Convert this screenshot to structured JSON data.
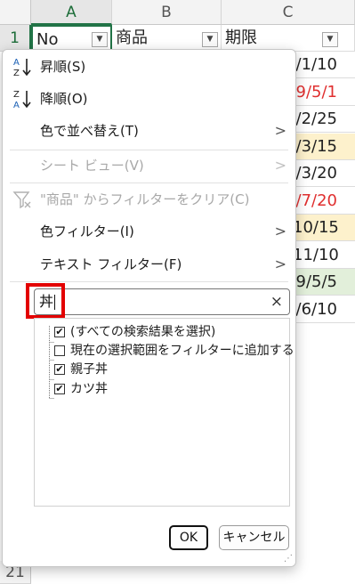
{
  "sheet": {
    "columns": [
      "A",
      "B",
      "C"
    ],
    "header_cells": {
      "a": "No",
      "b": "商品",
      "c": "期限"
    },
    "row_numbers": {
      "first": "1",
      "last": "21"
    },
    "dates": [
      {
        "text": "/1/10",
        "color": "#222222",
        "bg": "#ffffff"
      },
      {
        "text": "9/5/1",
        "color": "#e03030",
        "bg": "#ffffff"
      },
      {
        "text": "/2/25",
        "color": "#222222",
        "bg": "#ffffff"
      },
      {
        "text": "/3/15",
        "color": "#222222",
        "bg": "#fdf1cc"
      },
      {
        "text": "/3/20",
        "color": "#222222",
        "bg": "#ffffff"
      },
      {
        "text": "/7/20",
        "color": "#e03030",
        "bg": "#ffffff"
      },
      {
        "text": "10/15",
        "color": "#222222",
        "bg": "#fdf1cc"
      },
      {
        "text": "11/10",
        "color": "#222222",
        "bg": "#ffffff"
      },
      {
        "text": "9/5/5",
        "color": "#222222",
        "bg": "#e2efda"
      },
      {
        "text": "/6/10",
        "color": "#222222",
        "bg": "#ffffff"
      }
    ]
  },
  "menu": {
    "sort_asc": "昇順(S)",
    "sort_desc": "降順(O)",
    "sort_by_color": "色で並べ替え(T)",
    "sheet_view": "シート ビュー(V)",
    "clear_filter": "\"商品\" からフィルターをクリア(C)",
    "color_filter": "色フィルター(I)",
    "text_filter": "テキスト フィルター(F)",
    "chevron": ">"
  },
  "search": {
    "value": "丼",
    "clear": "×"
  },
  "tree": {
    "select_all": "(すべての検索結果を選択)",
    "add_to_filter": "現在の選択範囲をフィルターに追加する",
    "items": [
      "親子丼",
      "カツ丼"
    ]
  },
  "buttons": {
    "ok": "OK",
    "cancel": "キャンセル"
  },
  "colors": {
    "accent_green": "#217346",
    "highlight_red": "#e30000"
  }
}
